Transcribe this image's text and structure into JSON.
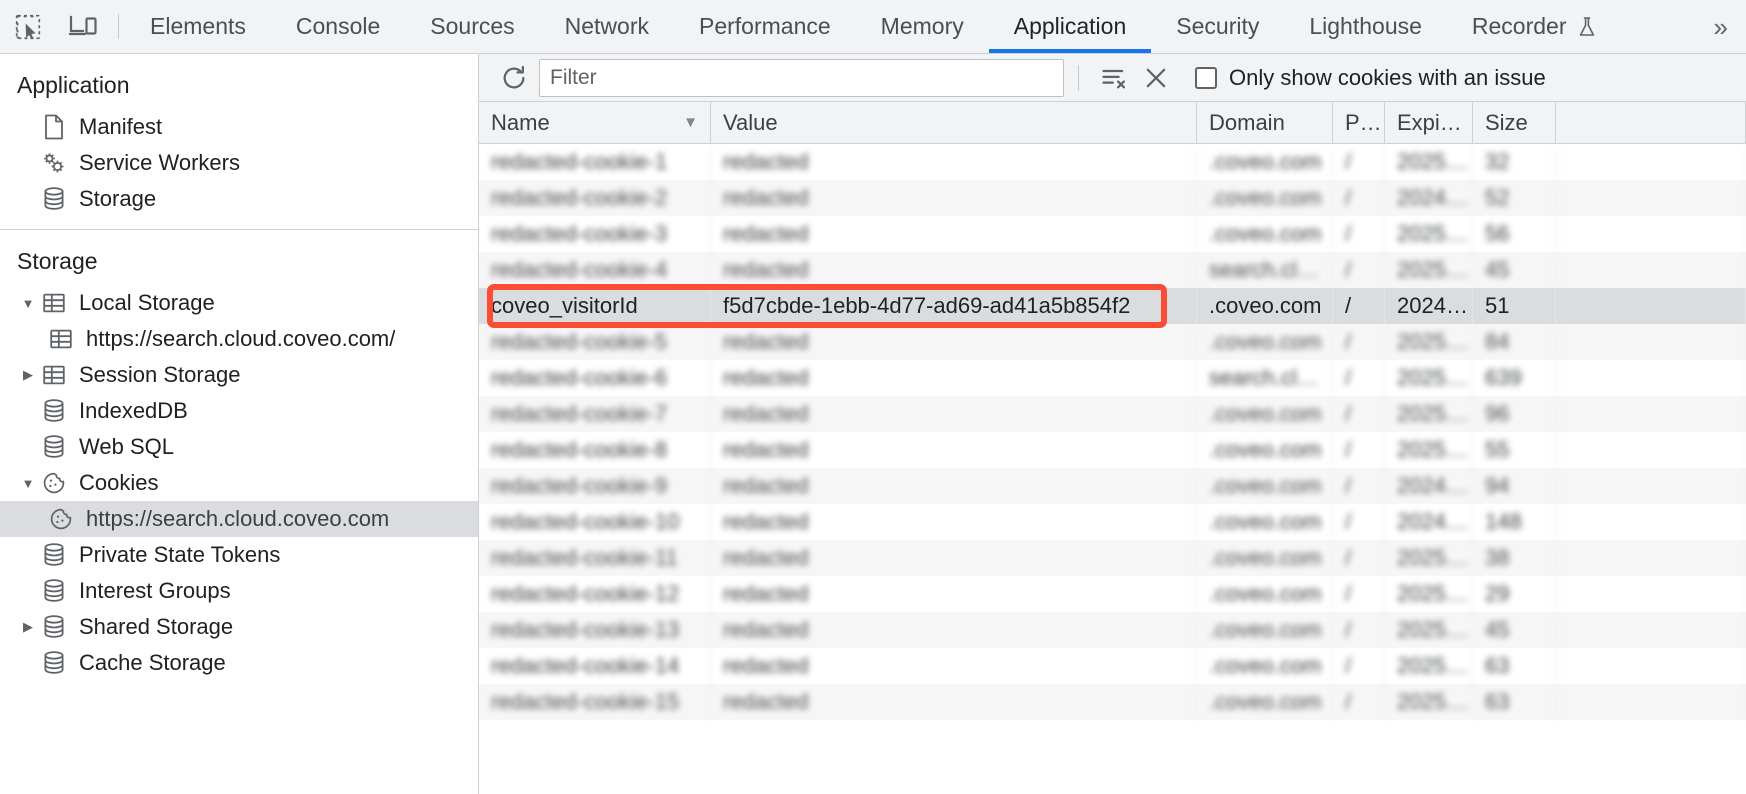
{
  "toolbar": {
    "inspect_icon": "inspect-element-icon",
    "device_icon": "device-toolbar-icon",
    "tabs": [
      {
        "label": "Elements",
        "active": false
      },
      {
        "label": "Console",
        "active": false
      },
      {
        "label": "Sources",
        "active": false
      },
      {
        "label": "Network",
        "active": false
      },
      {
        "label": "Performance",
        "active": false
      },
      {
        "label": "Memory",
        "active": false
      },
      {
        "label": "Application",
        "active": true
      },
      {
        "label": "Security",
        "active": false
      },
      {
        "label": "Lighthouse",
        "active": false
      },
      {
        "label": "Recorder",
        "active": false,
        "experimental": true
      }
    ],
    "overflow_label": "»",
    "active_tab": "Application",
    "accent_color": "#1a73e8"
  },
  "sidebar": {
    "sections": [
      {
        "title": "Application",
        "items": [
          {
            "label": "Manifest",
            "icon": "manifest-document-icon",
            "depth": 1,
            "twisty": "",
            "selected": false
          },
          {
            "label": "Service Workers",
            "icon": "service-workers-gears-icon",
            "depth": 1,
            "twisty": "",
            "selected": false
          },
          {
            "label": "Storage",
            "icon": "storage-database-icon",
            "depth": 1,
            "twisty": "",
            "selected": false
          }
        ]
      },
      {
        "title": "Storage",
        "items": [
          {
            "label": "Local Storage",
            "icon": "table-grid-icon",
            "depth": 1,
            "twisty": "expanded",
            "selected": false
          },
          {
            "label": "https://search.cloud.coveo.com/",
            "icon": "table-grid-icon",
            "depth": 2,
            "twisty": "",
            "selected": false
          },
          {
            "label": "Session Storage",
            "icon": "table-grid-icon",
            "depth": 1,
            "twisty": "collapsed",
            "selected": false
          },
          {
            "label": "IndexedDB",
            "icon": "storage-database-icon",
            "depth": 1,
            "twisty": "",
            "selected": false
          },
          {
            "label": "Web SQL",
            "icon": "storage-database-icon",
            "depth": 1,
            "twisty": "",
            "selected": false
          },
          {
            "label": "Cookies",
            "icon": "cookie-icon",
            "depth": 1,
            "twisty": "expanded",
            "selected": false
          },
          {
            "label": "https://search.cloud.coveo.com",
            "icon": "cookie-icon",
            "depth": 2,
            "twisty": "",
            "selected": true
          },
          {
            "label": "Private State Tokens",
            "icon": "storage-database-icon",
            "depth": 1,
            "twisty": "",
            "selected": false
          },
          {
            "label": "Interest Groups",
            "icon": "storage-database-icon",
            "depth": 1,
            "twisty": "",
            "selected": false
          },
          {
            "label": "Shared Storage",
            "icon": "storage-database-icon",
            "depth": 1,
            "twisty": "collapsed",
            "selected": false
          },
          {
            "label": "Cache Storage",
            "icon": "storage-database-icon",
            "depth": 1,
            "twisty": "",
            "selected": false
          }
        ]
      }
    ]
  },
  "cookies_panel": {
    "refresh_icon": "refresh-icon",
    "filter_placeholder": "Filter",
    "filter_value": "",
    "clear_filtered_icon": "clear-filtered-cookies-icon",
    "clear_all_icon": "clear-all-cookies-icon",
    "issue_checkbox_label": "Only show cookies with an issue",
    "issue_checkbox_checked": false,
    "columns": [
      {
        "key": "name",
        "label": "Name",
        "sorted": "desc"
      },
      {
        "key": "value",
        "label": "Value",
        "sorted": ""
      },
      {
        "key": "domain",
        "label": "Domain",
        "sorted": ""
      },
      {
        "key": "path",
        "label": "P…",
        "sorted": ""
      },
      {
        "key": "expires",
        "label": "Expi…",
        "sorted": ""
      },
      {
        "key": "size",
        "label": "Size",
        "sorted": ""
      },
      {
        "key": "extra",
        "label": "",
        "sorted": ""
      }
    ],
    "highlight_color": "#fb4c35",
    "rows": [
      {
        "name": "redacted-cookie-1",
        "value": "redacted",
        "domain": ".coveo.com",
        "path": "/",
        "expires": "2025…",
        "size": "32",
        "blurred": true,
        "highlighted": false
      },
      {
        "name": "redacted-cookie-2",
        "value": "redacted",
        "domain": ".coveo.com",
        "path": "/",
        "expires": "2024…",
        "size": "52",
        "blurred": true,
        "highlighted": false
      },
      {
        "name": "redacted-cookie-3",
        "value": "redacted",
        "domain": ".coveo.com",
        "path": "/",
        "expires": "2025…",
        "size": "56",
        "blurred": true,
        "highlighted": false
      },
      {
        "name": "redacted-cookie-4",
        "value": "redacted",
        "domain": "search.cl…",
        "path": "/",
        "expires": "2025…",
        "size": "45",
        "blurred": true,
        "highlighted": false
      },
      {
        "name": "coveo_visitorId",
        "value": "f5d7cbde-1ebb-4d77-ad69-ad41a5b854f2",
        "domain": ".coveo.com",
        "path": "/",
        "expires": "2024…",
        "size": "51",
        "blurred": false,
        "highlighted": true
      },
      {
        "name": "redacted-cookie-5",
        "value": "redacted",
        "domain": ".coveo.com",
        "path": "/",
        "expires": "2025…",
        "size": "84",
        "blurred": true,
        "highlighted": false
      },
      {
        "name": "redacted-cookie-6",
        "value": "redacted",
        "domain": "search.cl…",
        "path": "/",
        "expires": "2025…",
        "size": "639",
        "blurred": true,
        "highlighted": false
      },
      {
        "name": "redacted-cookie-7",
        "value": "redacted",
        "domain": ".coveo.com",
        "path": "/",
        "expires": "2025…",
        "size": "96",
        "blurred": true,
        "highlighted": false
      },
      {
        "name": "redacted-cookie-8",
        "value": "redacted",
        "domain": ".coveo.com",
        "path": "/",
        "expires": "2025…",
        "size": "55",
        "blurred": true,
        "highlighted": false
      },
      {
        "name": "redacted-cookie-9",
        "value": "redacted",
        "domain": ".coveo.com",
        "path": "/",
        "expires": "2024…",
        "size": "94",
        "blurred": true,
        "highlighted": false
      },
      {
        "name": "redacted-cookie-10",
        "value": "redacted",
        "domain": ".coveo.com",
        "path": "/",
        "expires": "2024…",
        "size": "148",
        "blurred": true,
        "highlighted": false
      },
      {
        "name": "redacted-cookie-11",
        "value": "redacted",
        "domain": ".coveo.com",
        "path": "/",
        "expires": "2025…",
        "size": "38",
        "blurred": true,
        "highlighted": false
      },
      {
        "name": "redacted-cookie-12",
        "value": "redacted",
        "domain": ".coveo.com",
        "path": "/",
        "expires": "2025…",
        "size": "29",
        "blurred": true,
        "highlighted": false
      },
      {
        "name": "redacted-cookie-13",
        "value": "redacted",
        "domain": ".coveo.com",
        "path": "/",
        "expires": "2025…",
        "size": "45",
        "blurred": true,
        "highlighted": false
      },
      {
        "name": "redacted-cookie-14",
        "value": "redacted",
        "domain": ".coveo.com",
        "path": "/",
        "expires": "2025…",
        "size": "63",
        "blurred": true,
        "highlighted": false
      },
      {
        "name": "redacted-cookie-15",
        "value": "redacted",
        "domain": ".coveo.com",
        "path": "/",
        "expires": "2025…",
        "size": "63",
        "blurred": true,
        "highlighted": false
      }
    ]
  }
}
